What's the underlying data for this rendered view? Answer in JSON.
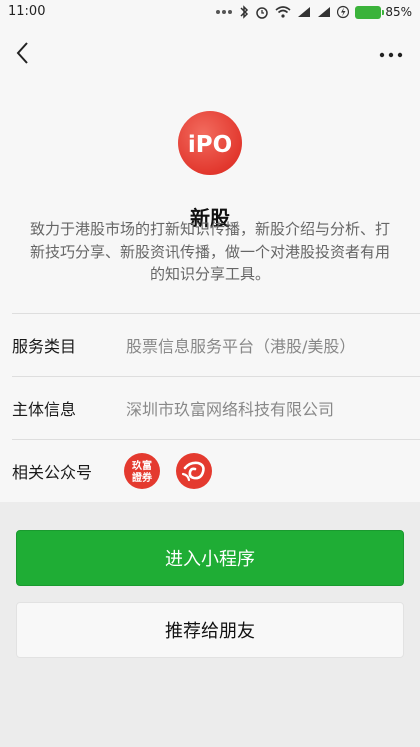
{
  "status_bar": {
    "time": "11:00",
    "battery_percent": "85%",
    "colors": {
      "battery": "#3bb33b"
    }
  },
  "nav": {
    "back_icon": "chevron-left-icon",
    "more_icon": "more-dots-icon"
  },
  "profile": {
    "logo_text": "iPO",
    "name": "新股",
    "description": "致力于港股市场的打新知识传播，新股介绍与分析、打新技巧分享、新股资讯传播，做一个对港股投资者有用的知识分享工具。"
  },
  "info_rows": {
    "service_category": {
      "label": "服务类目",
      "value": "股票信息服务平台（港股/美股）"
    },
    "entity_info": {
      "label": "主体信息",
      "value": "深圳市玖富网络科技有限公司"
    },
    "related_accounts": {
      "label": "相关公众号",
      "accounts": [
        {
          "logo_text": "玖富證券",
          "icon": "jiufu-securities-logo"
        },
        {
          "logo_text": "",
          "icon": "swirl-logo"
        }
      ]
    }
  },
  "actions": {
    "enter_label": "进入小程序",
    "recommend_label": "推荐给朋友"
  },
  "colors": {
    "brand_red": "#e2382e",
    "primary_green": "#1fad35"
  }
}
